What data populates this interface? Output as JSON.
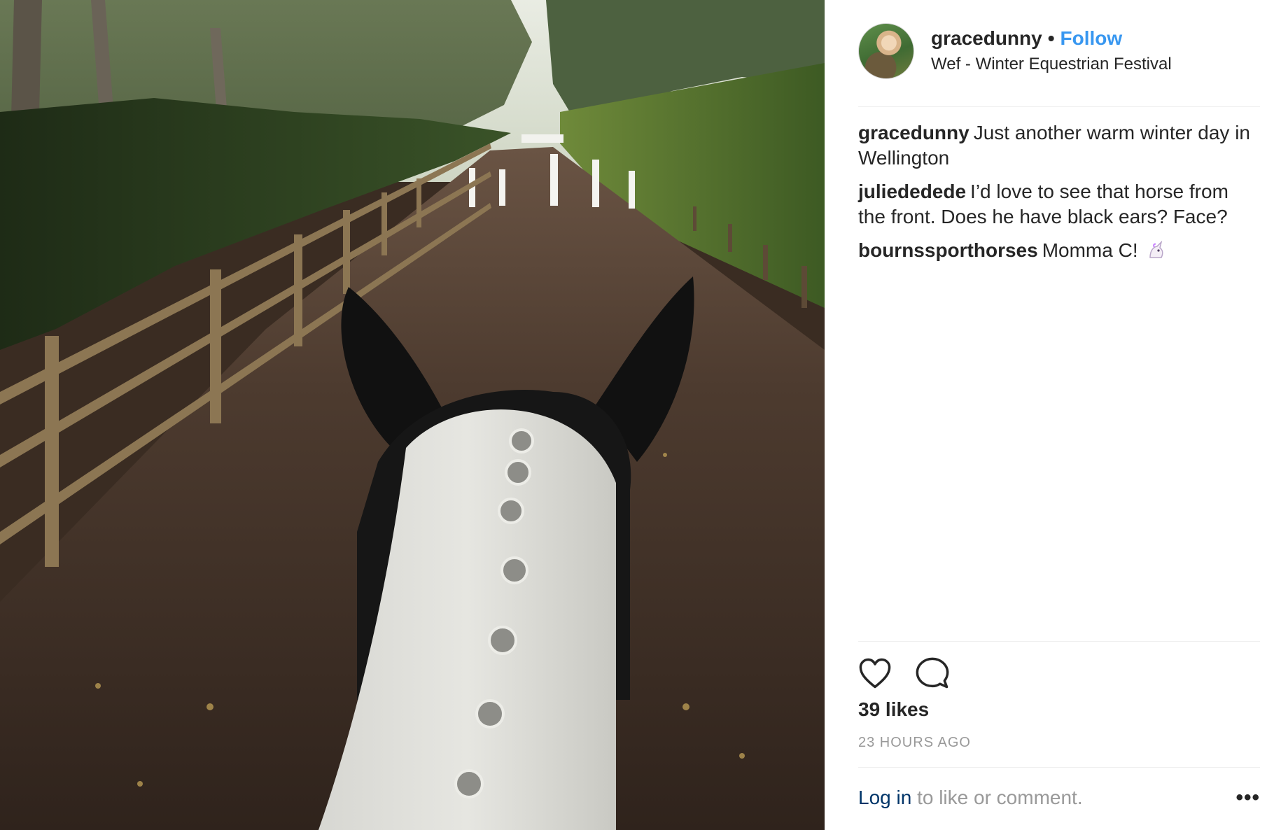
{
  "post": {
    "image_alt": "Horse ears and braided mane on a tree-lined dirt path",
    "header": {
      "username": "gracedunny",
      "separator": "•",
      "follow_label": "Follow",
      "location": "Wef - Winter Equestrian Festival"
    },
    "comments": [
      {
        "author": "gracedunny",
        "text": "Just another warm winter day in Wellington"
      },
      {
        "author": "juliededede",
        "text": "I’d love to see that horse from the front. Does he have black ears? Face?"
      },
      {
        "author": "bournssporthorses",
        "text": "Momma C!",
        "emoji": "unicorn-icon"
      }
    ],
    "likes": "39 likes",
    "timestamp": "23 HOURS AGO",
    "footer": {
      "login_link": "Log in",
      "login_rest": "to like or comment.",
      "more_label": "•••"
    },
    "icons": [
      "heart-icon",
      "comment-icon",
      "unicorn-icon"
    ],
    "colors": {
      "follow": "#3897f0",
      "link": "#003569",
      "muted": "#999999",
      "text": "#262626",
      "divider": "#efefef"
    }
  }
}
